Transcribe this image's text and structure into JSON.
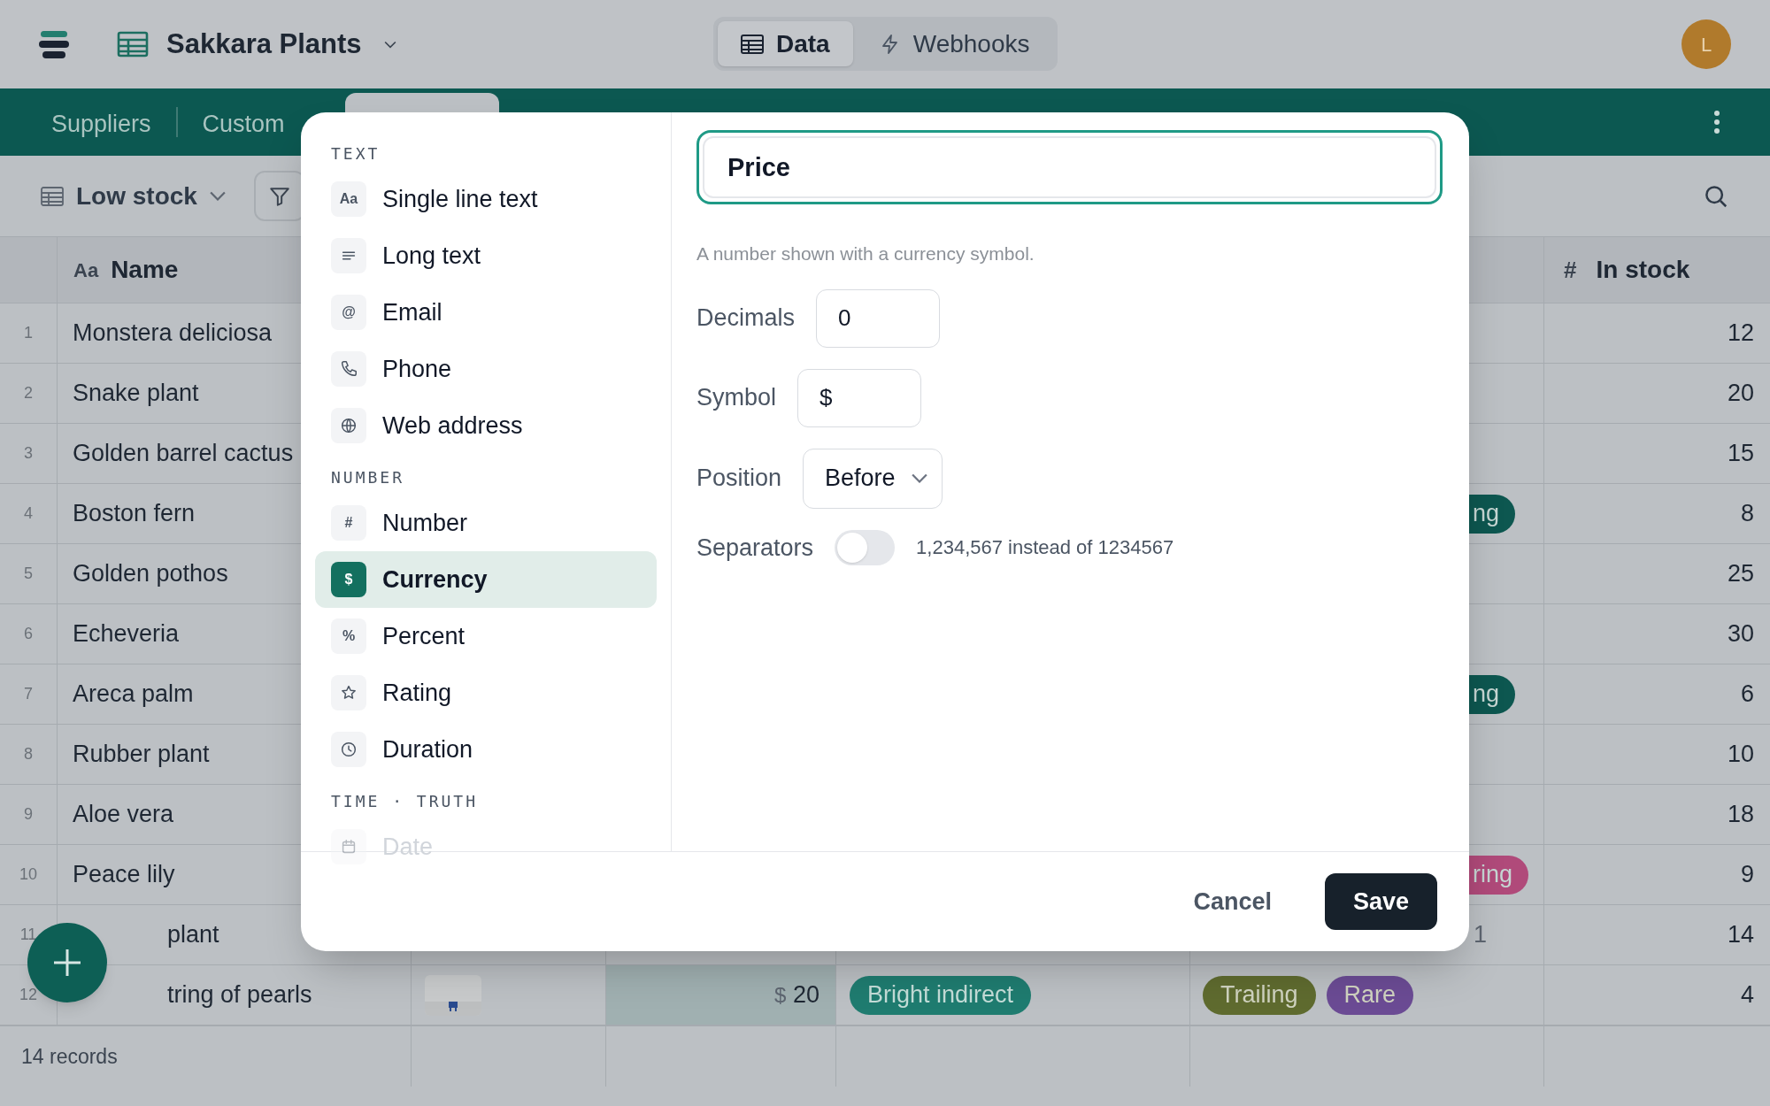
{
  "app": {
    "title": "Sakkara Plants",
    "avatar": "L"
  },
  "mode_tabs": [
    {
      "label": "Data",
      "kind": "table",
      "selected": true
    },
    {
      "label": "Webhooks",
      "kind": "bolt",
      "selected": false
    }
  ],
  "table_tabs": [
    {
      "label": "Suppliers",
      "selected": false
    },
    {
      "label": "Custom",
      "selected": false
    },
    {
      "selected": true
    }
  ],
  "toolbar": {
    "view": "Low stock"
  },
  "table": {
    "columns": [
      {
        "mark": "Aa",
        "label": "Name"
      },
      {
        "mark": "#",
        "label": "In stock"
      }
    ],
    "rows": [
      {
        "number": "1",
        "name": "Monstera deliciosa",
        "in_stock": "12"
      },
      {
        "number": "2",
        "name": "Snake plant",
        "in_stock": "20"
      },
      {
        "number": "3",
        "name": "Golden barrel cactus",
        "in_stock": "15"
      },
      {
        "number": "4",
        "name": "Boston fern",
        "in_stock": "8",
        "fragment": {
          "kind": "tag",
          "text": "ng",
          "color": "#0d5750"
        }
      },
      {
        "number": "5",
        "name": "Golden pothos",
        "in_stock": "25"
      },
      {
        "number": "6",
        "name": "Echeveria",
        "in_stock": "30"
      },
      {
        "number": "7",
        "name": "Areca palm",
        "in_stock": "6",
        "fragment": {
          "kind": "tag",
          "text": "ng",
          "color": "#0d5750"
        }
      },
      {
        "number": "8",
        "name": "Rubber plant",
        "in_stock": "10"
      },
      {
        "number": "9",
        "name": "Aloe vera",
        "in_stock": "18"
      },
      {
        "number": "10",
        "name": "Peace lily",
        "in_stock": "9",
        "fragment": {
          "kind": "tag",
          "text": "ring",
          "color": "#b04a7a"
        }
      },
      {
        "number": "11",
        "name": "plant",
        "behind_add_button": true,
        "in_stock": "14",
        "fragment": {
          "kind": "text",
          "text": "1"
        }
      },
      {
        "number": "12",
        "name": "tring of pearls",
        "behind_add_button": true,
        "in_stock": "4",
        "photo": {
          "kind": "picture"
        },
        "price": {
          "symbol": "$",
          "amount": "20"
        },
        "light": {
          "text": "Bright indirect",
          "color": "#1f7c70"
        },
        "tags": [
          {
            "text": "Trailing",
            "color": "#5f6b2f"
          },
          {
            "text": "Rare",
            "color": "#6b4b94"
          }
        ]
      }
    ]
  },
  "footer": {
    "records": "14 records"
  },
  "modal": {
    "groups": [
      {
        "heading": "TEXT",
        "items": [
          {
            "label": "Single line text",
            "kind": "glyph",
            "glyph": "Aa",
            "selected": false,
            "faded": false
          },
          {
            "label": "Long text",
            "kind": "lines",
            "selected": false,
            "faded": false
          },
          {
            "label": "Email",
            "kind": "glyph",
            "glyph": "@",
            "selected": false,
            "faded": false
          },
          {
            "label": "Phone",
            "kind": "phone",
            "selected": false,
            "faded": false
          },
          {
            "label": "Web address",
            "kind": "globe",
            "selected": false,
            "faded": false
          }
        ]
      },
      {
        "heading": "NUMBER",
        "items": [
          {
            "label": "Number",
            "kind": "glyph",
            "glyph": "#",
            "selected": false,
            "faded": false
          },
          {
            "label": "Currency",
            "kind": "glyph",
            "glyph": "$",
            "selected": true,
            "faded": false
          },
          {
            "label": "Percent",
            "kind": "glyph",
            "glyph": "%",
            "selected": false,
            "faded": false
          },
          {
            "label": "Rating",
            "kind": "star",
            "selected": false,
            "faded": false
          },
          {
            "label": "Duration",
            "kind": "clock",
            "selected": false,
            "faded": false
          }
        ]
      },
      {
        "heading": "TIME · TRUTH",
        "items": [
          {
            "label": "Date",
            "kind": "calendar",
            "selected": false,
            "faded": true
          }
        ]
      }
    ],
    "name_value": "Price",
    "description": "A number shown with a currency symbol.",
    "settings": [
      {
        "kind": "input",
        "label": "Decimals",
        "value": "0"
      },
      {
        "kind": "input",
        "label": "Symbol",
        "value": "$"
      },
      {
        "kind": "select",
        "label": "Position",
        "value": "Before"
      },
      {
        "kind": "toggle",
        "label": "Separators",
        "on": false,
        "hint": "1,234,567 instead of 1234567"
      }
    ],
    "buttons": [
      {
        "label": "Cancel",
        "kind": "secondary"
      },
      {
        "label": "Save",
        "kind": "primary"
      }
    ]
  }
}
